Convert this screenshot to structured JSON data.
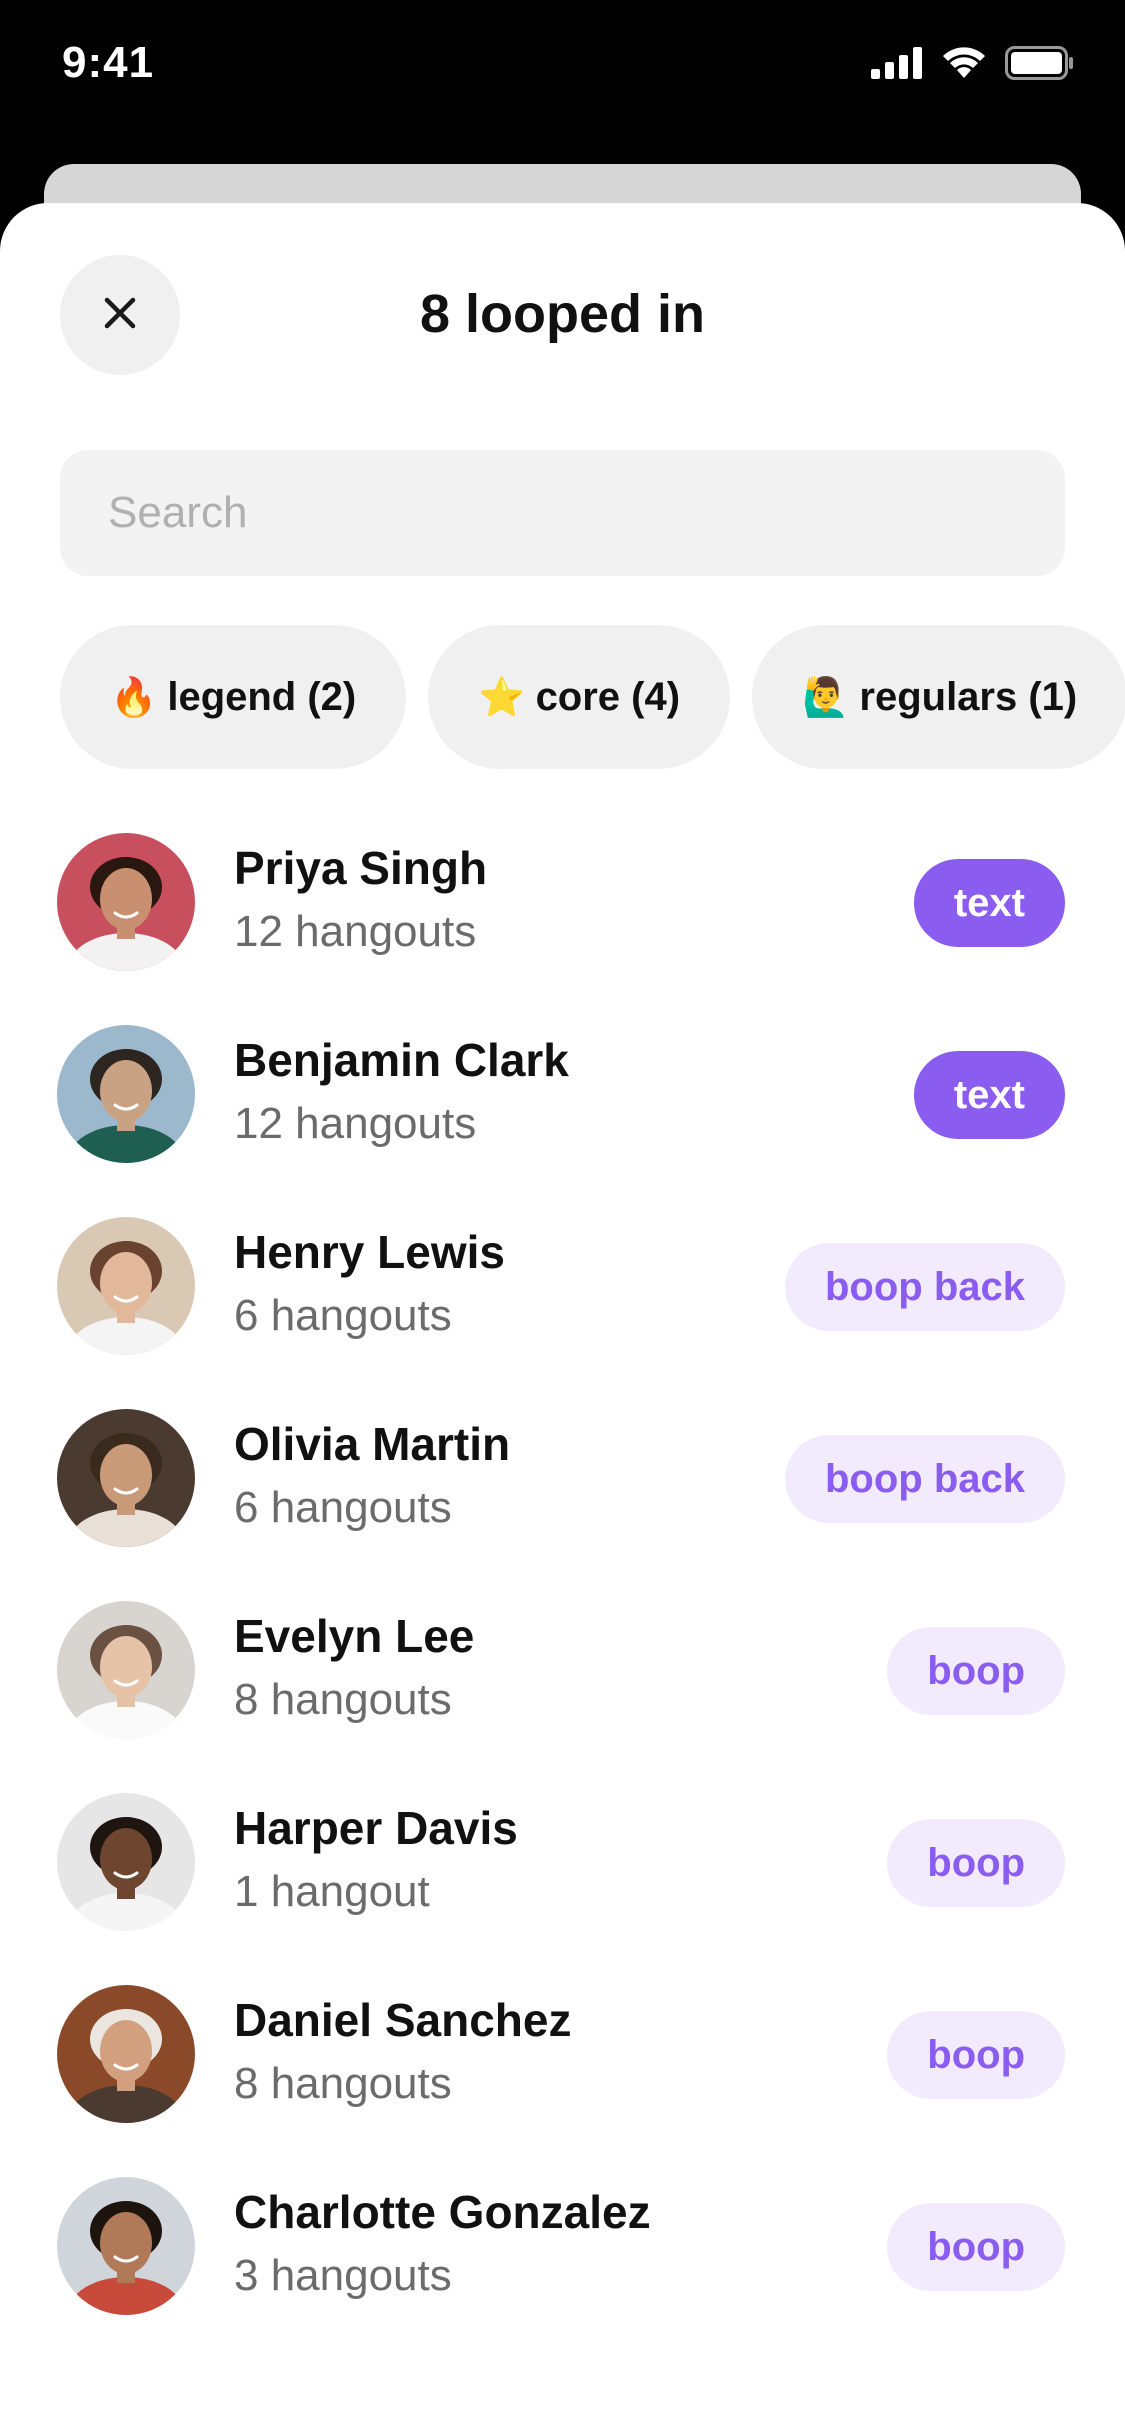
{
  "status_bar": {
    "time": "9:41"
  },
  "header": {
    "title": "8 looped in",
    "close_icon": "close-icon"
  },
  "search": {
    "placeholder": "Search",
    "value": ""
  },
  "filters": [
    {
      "emoji": "🔥",
      "label": "legend (2)"
    },
    {
      "emoji": "⭐",
      "label": "core (4)"
    },
    {
      "emoji": "🙋‍♂️",
      "label": "regulars (1)"
    }
  ],
  "people": [
    {
      "name": "Priya Singh",
      "hangouts": "12 hangouts",
      "action": "text",
      "action_style": "primary",
      "avatar_bg": "#c8505e",
      "skin": "#c89070",
      "hair": "#2a1810",
      "shirt": "#f2f2f2"
    },
    {
      "name": "Benjamin Clark",
      "hangouts": "12 hangouts",
      "action": "text",
      "action_style": "primary",
      "avatar_bg": "#9cb8cc",
      "skin": "#c9a283",
      "hair": "#2c2520",
      "shirt": "#1f5f52"
    },
    {
      "name": "Henry Lewis",
      "hangouts": "6 hangouts",
      "action": "boop back",
      "action_style": "soft",
      "avatar_bg": "#d9c8b4",
      "skin": "#e2b89b",
      "hair": "#6a4330",
      "shirt": "#f4f4f4"
    },
    {
      "name": "Olivia Martin",
      "hangouts": "6 hangouts",
      "action": "boop back",
      "action_style": "soft",
      "avatar_bg": "#4a3a30",
      "skin": "#c99a78",
      "hair": "#3a2a1e",
      "shirt": "#e8e0d6"
    },
    {
      "name": "Evelyn Lee",
      "hangouts": "8 hangouts",
      "action": "boop",
      "action_style": "soft",
      "avatar_bg": "#d8d4d0",
      "skin": "#e6c2a6",
      "hair": "#6b5142",
      "shirt": "#fafafa"
    },
    {
      "name": "Harper Davis",
      "hangouts": "1 hangout",
      "action": "boop",
      "action_style": "soft",
      "avatar_bg": "#e6e6e6",
      "skin": "#6e4630",
      "hair": "#1e1410",
      "shirt": "#f5f5f5"
    },
    {
      "name": "Daniel Sanchez",
      "hangouts": "8 hangouts",
      "action": "boop",
      "action_style": "soft",
      "avatar_bg": "#8a4a2a",
      "skin": "#d3a07f",
      "hair": "#ebe6e0",
      "shirt": "#4a3a30"
    },
    {
      "name": "Charlotte Gonzalez",
      "hangouts": "3 hangouts",
      "action": "boop",
      "action_style": "soft",
      "avatar_bg": "#cfd5da",
      "skin": "#b07a58",
      "hair": "#1e140e",
      "shirt": "#c84a3a"
    }
  ]
}
